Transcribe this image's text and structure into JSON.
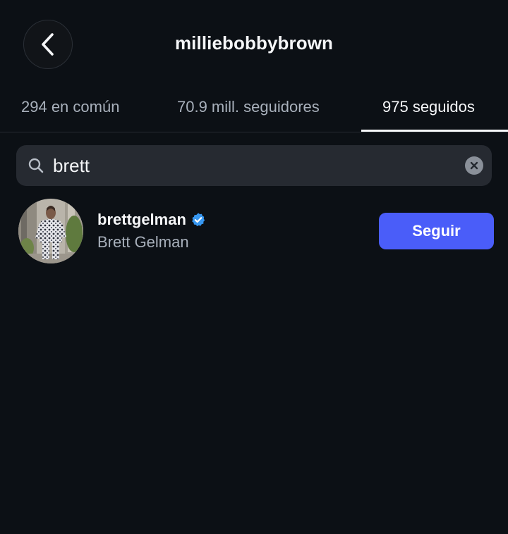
{
  "header": {
    "title": "milliebobbybrown",
    "back_icon": "chevron-left-icon"
  },
  "tabs": [
    {
      "label": "294 en común",
      "active": false
    },
    {
      "label": "70.9 mill. seguidores",
      "active": false
    },
    {
      "label": "975 seguidos",
      "active": true
    }
  ],
  "search": {
    "icon": "search-icon",
    "value": "brett",
    "clear_icon": "clear-icon"
  },
  "results": [
    {
      "username": "brettgelman",
      "full_name": "Brett Gelman",
      "verified": true,
      "follow_label": "Seguir"
    }
  ],
  "colors": {
    "background": "#0c1015",
    "search_bg": "#262a31",
    "primary_button": "#4a5df9",
    "verified_badge": "#3797f0",
    "secondary_text": "#a8b0bb"
  }
}
